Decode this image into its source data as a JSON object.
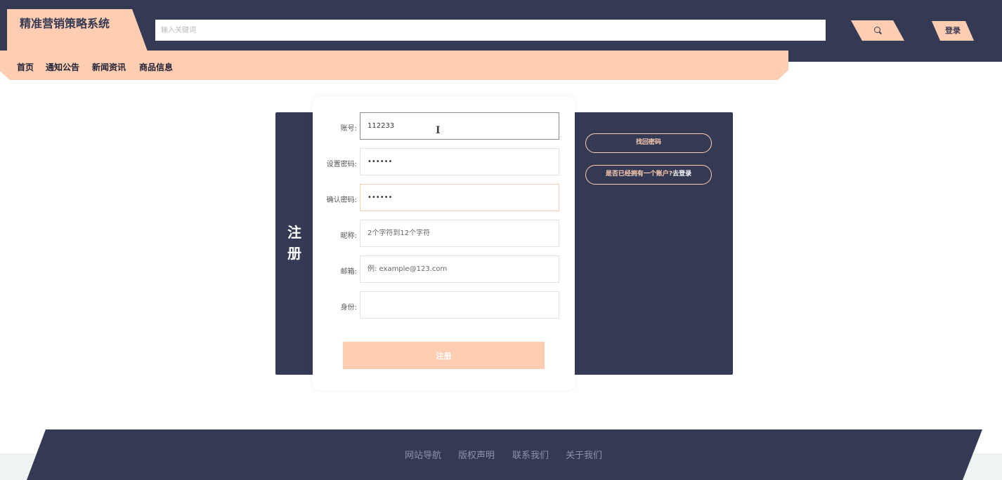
{
  "header": {
    "brand": "精准营销策略系统",
    "search_placeholder": "输入关键词",
    "search_icon": "search-icon",
    "login_label": "登录"
  },
  "nav": [
    {
      "label": "首页"
    },
    {
      "label": "通知公告"
    },
    {
      "label": "新闻资讯"
    },
    {
      "label": "商品信息"
    }
  ],
  "register": {
    "title": "注册",
    "fields": [
      {
        "label": "账号:",
        "value": "112233",
        "placeholder": ""
      },
      {
        "label": "设置密码:",
        "value": "••••••",
        "placeholder": ""
      },
      {
        "label": "确认密码:",
        "value": "••••••",
        "placeholder": ""
      },
      {
        "label": "昵称:",
        "value": "",
        "placeholder": "2个字符到12个字符"
      },
      {
        "label": "邮箱:",
        "value": "",
        "placeholder": "例: example@123.com"
      },
      {
        "label": "身份:",
        "value": "",
        "placeholder": ""
      }
    ],
    "submit_label": "注册",
    "forgot_label": "找回密码",
    "have_account_prefix": "是否已经拥有一个账户?",
    "have_account_link": "去登录"
  },
  "footer": {
    "links": [
      "网站导航",
      "版权声明",
      "联系我们",
      "关于我们"
    ]
  },
  "colors": {
    "primary_dark": "#353a54",
    "accent_peach": "#ffcdb2",
    "background": "#ffffff"
  }
}
